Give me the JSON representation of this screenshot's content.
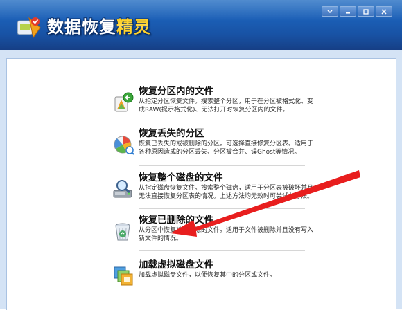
{
  "app": {
    "title_part1": "数据恢复",
    "title_part2": "精灵"
  },
  "window_controls": {
    "menu_glyph": "▾",
    "minimize_glyph": "−",
    "maximize_glyph": "□",
    "close_glyph": "✕"
  },
  "options": [
    {
      "title": "恢复分区内的文件",
      "description": "从指定分区恢复文件。搜索整个分区，用于在分区被格式化、变成RAW(提示格式化)、无法打开时恢复分区内的文件。",
      "icon": "partition-files-icon"
    },
    {
      "title": "恢复丢失的分区",
      "description": "恢复已丢失的或被删除的分区。可选择直接修复分区表。适用于各种原因造成的分区丢失、分区被合并、误Ghost等情况。",
      "icon": "lost-partition-icon"
    },
    {
      "title": "恢复整个磁盘的文件",
      "description": "从指定磁盘恢复文件。搜索整个磁盘，适用于分区表被破坏并且无法直接恢复分区表的情况。上述方法均无效时可尝试此方法。",
      "icon": "disk-scan-icon"
    },
    {
      "title": "恢复已删除的文件",
      "description": "从分区中恢复被误删除的文件。适用于文件被删除并且没有写入新文件的情况。",
      "icon": "recycle-bin-icon"
    },
    {
      "title": "加载虚拟磁盘文件",
      "description": "加载虚拟磁盘文件，以便恢复其中的分区或文件。",
      "icon": "virtual-disk-icon"
    }
  ],
  "colors": {
    "banner": "#1b5fb6",
    "title_accent": "#ffd22c",
    "annotation_arrow": "#e81e1e"
  }
}
